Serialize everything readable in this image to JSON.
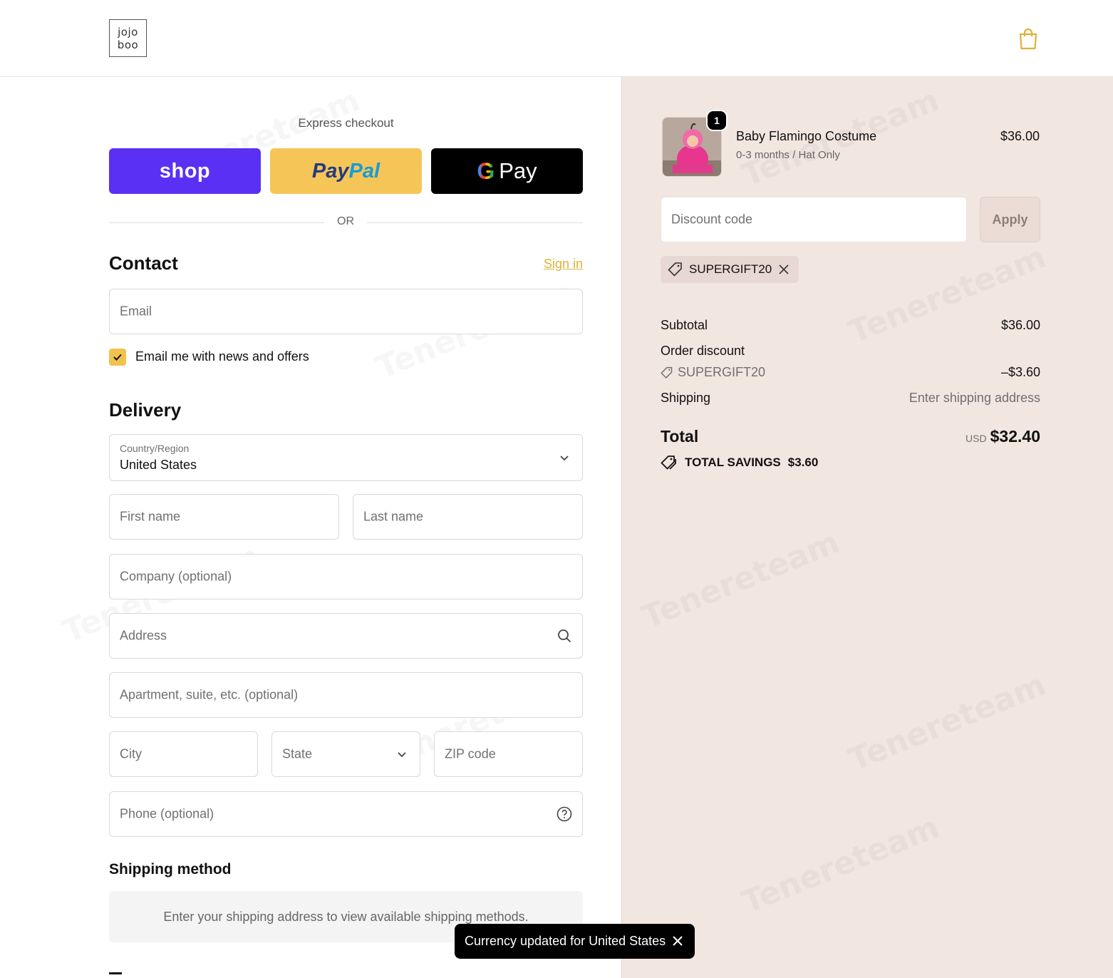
{
  "header": {
    "logo_line1": "jojo",
    "logo_line2": "boo",
    "cart_icon": "shopping-bag-icon"
  },
  "express": {
    "title": "Express checkout",
    "shop_label": "shop",
    "paypal_part1": "Pay",
    "paypal_part2": "Pal",
    "gpay_g": "G",
    "gpay_label": "Pay",
    "or_text": "OR"
  },
  "contact": {
    "title": "Contact",
    "signin": "Sign in",
    "email_placeholder": "Email",
    "newsletter_label": "Email me with news and offers",
    "newsletter_checked": true
  },
  "delivery": {
    "title": "Delivery",
    "country_label": "Country/Region",
    "country_value": "United States",
    "first_name": "First name",
    "last_name": "Last name",
    "company": "Company (optional)",
    "address": "Address",
    "apartment": "Apartment, suite, etc. (optional)",
    "city": "City",
    "state": "State",
    "zip": "ZIP code",
    "phone": "Phone (optional)"
  },
  "shipping_method": {
    "title": "Shipping method",
    "message": "Enter your shipping address to view available shipping methods."
  },
  "order": {
    "item": {
      "name": "Baby Flamingo Costume",
      "variant": "0-3 months / Hat Only",
      "price": "$36.00",
      "quantity": "1"
    },
    "discount_placeholder": "Discount code",
    "apply_label": "Apply",
    "applied_code": "SUPERGIFT20",
    "subtotal_label": "Subtotal",
    "subtotal_value": "$36.00",
    "order_discount_label": "Order discount",
    "discount_code": "SUPERGIFT20",
    "discount_value": "–$3.60",
    "shipping_label": "Shipping",
    "shipping_value": "Enter shipping address",
    "total_label": "Total",
    "currency": "USD",
    "total_value": "$32.40",
    "savings_label": "TOTAL SAVINGS",
    "savings_value": "$3.60"
  },
  "toast": {
    "message": "Currency updated for United States"
  },
  "watermark": "Tenereteam",
  "colors": {
    "accent": "#f1c24e",
    "shop_pay": "#5a31f4",
    "paypal": "#f6c557",
    "summary_bg": "#f2e6e1"
  }
}
